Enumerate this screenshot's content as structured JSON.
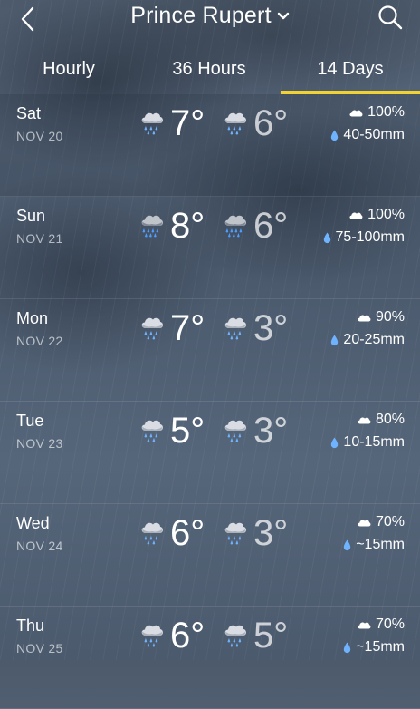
{
  "header": {
    "title": "Prince Rupert",
    "icons": {
      "back": "chevron-left-icon",
      "location_menu": "chevron-down-icon",
      "search": "search-icon"
    }
  },
  "tabs": [
    {
      "label": "Hourly",
      "active": false
    },
    {
      "label": "36 Hours",
      "active": false
    },
    {
      "label": "14 Days",
      "active": true
    }
  ],
  "colors": {
    "active_tab_underline": "#f2d230",
    "rain_drop": "#6fb3ff"
  },
  "days": [
    {
      "day": "Sat",
      "date": "NOV 20",
      "high": "7°",
      "low": "6°",
      "chance": "100%",
      "amount": "40-50mm",
      "day_icon": "cloud-rain-icon",
      "night_icon": "cloud-rain-icon"
    },
    {
      "day": "Sun",
      "date": "NOV 21",
      "high": "8°",
      "low": "6°",
      "chance": "100%",
      "amount": "75-100mm",
      "day_icon": "cloud-heavy-rain-icon",
      "night_icon": "cloud-heavy-rain-icon"
    },
    {
      "day": "Mon",
      "date": "NOV 22",
      "high": "7°",
      "low": "3°",
      "chance": "90%",
      "amount": "20-25mm",
      "day_icon": "cloud-rain-icon",
      "night_icon": "cloud-rain-icon"
    },
    {
      "day": "Tue",
      "date": "NOV 23",
      "high": "5°",
      "low": "3°",
      "chance": "80%",
      "amount": "10-15mm",
      "day_icon": "cloud-rain-icon",
      "night_icon": "cloud-rain-icon"
    },
    {
      "day": "Wed",
      "date": "NOV 24",
      "high": "6°",
      "low": "3°",
      "chance": "70%",
      "amount": "~15mm",
      "day_icon": "cloud-rain-icon",
      "night_icon": "cloud-rain-icon"
    },
    {
      "day": "Thu",
      "date": "NOV 25",
      "high": "6°",
      "low": "5°",
      "chance": "70%",
      "amount": "~15mm",
      "day_icon": "cloud-rain-icon",
      "night_icon": "cloud-rain-icon"
    }
  ]
}
